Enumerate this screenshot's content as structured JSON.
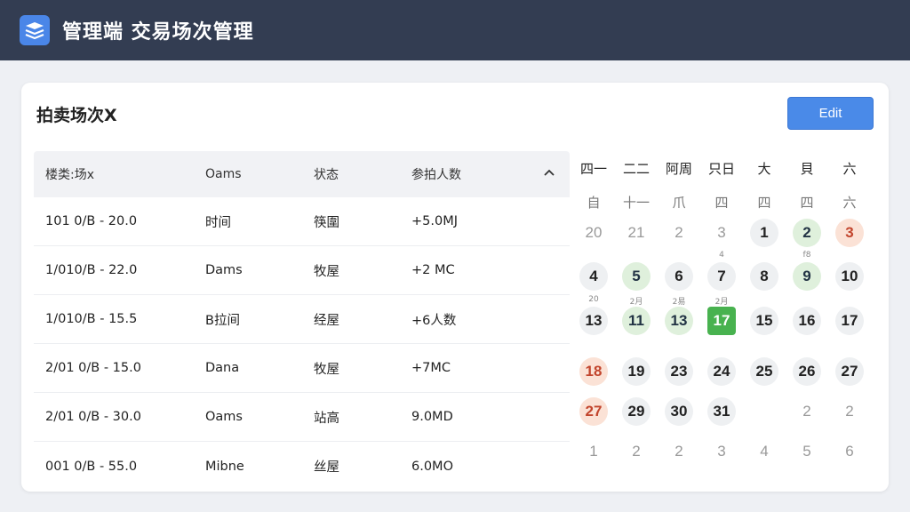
{
  "app": {
    "title": "管理端 交易场次管理"
  },
  "card": {
    "title": "拍卖场次X",
    "edit_label": "Edit"
  },
  "table": {
    "headers": [
      "楼类:场x",
      "Oams",
      "状态",
      "参拍人数"
    ],
    "rows": [
      [
        "101 0/B - 20.0",
        "时间",
        "筷圍",
        "+5.0MJ"
      ],
      [
        "1/010/B - 22.0",
        "Dams",
        "牧屋",
        "+2 MC"
      ],
      [
        "1/010/B - 15.5",
        "B拉间",
        "经屋",
        "+6人数"
      ],
      [
        "2/01 0/B - 15.0",
        "Dana",
        "牧屋",
        "+7MC"
      ],
      [
        "2/01 0/B - 30.0",
        "Oams",
        "站高",
        "9.0MD"
      ],
      [
        "001 0/B - 55.0",
        "Mibne",
        "丝屋",
        "6.0MO"
      ]
    ]
  },
  "calendar": {
    "weekdays": [
      "四一",
      "二二",
      "阿周",
      "只日",
      "大",
      "貝",
      "六"
    ],
    "subheads": [
      "自",
      "十一",
      "爪",
      "四",
      "四",
      "四",
      "六"
    ],
    "rows": [
      [
        {
          "t": "20",
          "s": "muted"
        },
        {
          "t": "21",
          "s": "muted"
        },
        {
          "t": "2",
          "s": "muted"
        },
        {
          "t": "3",
          "s": "muted"
        },
        {
          "t": "1",
          "s": "gray"
        },
        {
          "t": "2",
          "s": "green"
        },
        {
          "t": "3",
          "s": "orange"
        }
      ],
      [
        {
          "t": "4",
          "s": "gray"
        },
        {
          "t": "5",
          "s": "green"
        },
        {
          "t": "6",
          "s": "gray"
        },
        {
          "t": "7",
          "s": "gray"
        },
        {
          "t": "8",
          "s": "gray"
        },
        {
          "t": "9",
          "s": "green"
        },
        {
          "t": "10",
          "s": "gray"
        }
      ],
      [
        {
          "t": "13",
          "s": "gray"
        },
        {
          "t": "11",
          "s": "green"
        },
        {
          "t": "13",
          "s": "green"
        },
        {
          "t": "17",
          "s": "active"
        },
        {
          "t": "15",
          "s": "gray"
        },
        {
          "t": "16",
          "s": "gray"
        },
        {
          "t": "17",
          "s": "gray"
        }
      ],
      [
        {
          "t": "18",
          "s": "orange"
        },
        {
          "t": "19",
          "s": "gray"
        },
        {
          "t": "23",
          "s": "gray"
        },
        {
          "t": "24",
          "s": "gray"
        },
        {
          "t": "25",
          "s": "gray"
        },
        {
          "t": "26",
          "s": "gray"
        },
        {
          "t": "27",
          "s": "gray"
        }
      ],
      [
        {
          "t": "27",
          "s": "orange"
        },
        {
          "t": "29",
          "s": "gray"
        },
        {
          "t": "30",
          "s": "gray"
        },
        {
          "t": "31",
          "s": "gray"
        },
        {
          "t": "",
          "s": "none"
        },
        {
          "t": "2",
          "s": "muted"
        },
        {
          "t": "2",
          "s": "muted"
        }
      ],
      [
        {
          "t": "1",
          "s": "muted"
        },
        {
          "t": "2",
          "s": "muted"
        },
        {
          "t": "2",
          "s": "muted"
        },
        {
          "t": "3",
          "s": "muted"
        },
        {
          "t": "4",
          "s": "muted"
        },
        {
          "t": "5",
          "s": "muted"
        },
        {
          "t": "6",
          "s": "muted"
        }
      ]
    ],
    "small_labels": {
      "r2": [
        "",
        "",
        "",
        "4",
        "",
        "f8",
        ""
      ],
      "r3": [
        "20",
        "2月",
        "2易",
        "2月",
        "",
        "",
        ""
      ]
    }
  },
  "colors": {
    "topbar": "#333d52",
    "accent": "#4a8ae8",
    "active_green": "#48b24f",
    "green_circle": "#dff0dc",
    "orange_circle": "#fbe2d6"
  },
  "icons": {
    "logo": "stack-layers-icon",
    "sort": "chevron-up-icon"
  }
}
